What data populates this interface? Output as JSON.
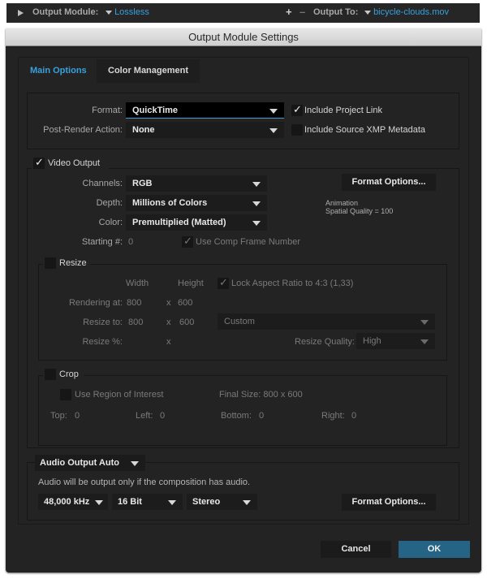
{
  "topbar": {
    "expand_icon": "triangle-right-icon",
    "output_module_label": "Output Module:",
    "output_module_value": "Lossless",
    "add_label": "+",
    "remove_label": "–",
    "output_to_label": "Output To:",
    "output_to_value": "bicycle-clouds.mov"
  },
  "dialog": {
    "title": "Output Module Settings",
    "tabs": [
      {
        "label": "Main Options",
        "active": true
      },
      {
        "label": "Color Management",
        "active": false
      }
    ],
    "format_section": {
      "format_label": "Format:",
      "format_value": "QuickTime",
      "post_render_label": "Post-Render Action:",
      "post_render_value": "None",
      "include_project_link": {
        "label": "Include Project Link",
        "checked": true
      },
      "include_xmp": {
        "label": "Include Source XMP Metadata",
        "checked": false
      }
    },
    "video_output": {
      "label": "Video Output",
      "checked": true,
      "channels_label": "Channels:",
      "channels_value": "RGB",
      "depth_label": "Depth:",
      "depth_value": "Millions of Colors",
      "color_label": "Color:",
      "color_value": "Premultiplied (Matted)",
      "starting_label": "Starting #:",
      "starting_value": "0",
      "use_comp_frame": {
        "label": "Use Comp Frame Number",
        "checked": true
      },
      "format_options_label": "Format Options...",
      "codec_info_line1": "Animation",
      "codec_info_line2": "Spatial Quality = 100"
    },
    "resize": {
      "label": "Resize",
      "checked": false,
      "width_header": "Width",
      "height_header": "Height",
      "lock_aspect": {
        "label": "Lock Aspect Ratio to 4:3 (1,33)",
        "checked": true
      },
      "rendering_at_label": "Rendering at:",
      "rendering_width": "800",
      "rendering_height": "600",
      "resize_to_label": "Resize to:",
      "resize_width": "800",
      "resize_height": "600",
      "x_symbol": "x",
      "preset_value": "Custom",
      "resize_percent_label": "Resize %:",
      "quality_label": "Resize Quality:",
      "quality_value": "High"
    },
    "crop": {
      "label": "Crop",
      "checked": false,
      "use_roi": {
        "label": "Use Region of Interest",
        "checked": false
      },
      "final_size": "Final Size: 800 x 600",
      "top_label": "Top:",
      "top_value": "0",
      "left_label": "Left:",
      "left_value": "0",
      "bottom_label": "Bottom:",
      "bottom_value": "0",
      "right_label": "Right:",
      "right_value": "0"
    },
    "audio": {
      "mode_value": "Audio Output Auto",
      "note": "Audio will be output only if the composition has audio.",
      "rate_value": "48,000 kHz",
      "bits_value": "16 Bit",
      "channels_value": "Stereo",
      "format_options_label": "Format Options..."
    },
    "buttons": {
      "cancel": "Cancel",
      "ok": "OK"
    },
    "colors": {
      "accent": "#3aa0dc",
      "ok_button": "#266486",
      "background": "#232323"
    }
  }
}
